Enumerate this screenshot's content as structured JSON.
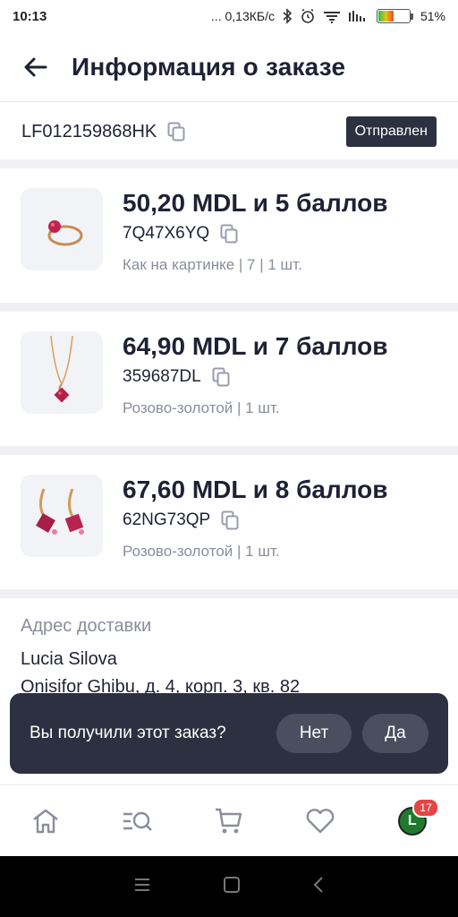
{
  "status_bar": {
    "time": "10:13",
    "net_speed": "... 0,13КБ/с",
    "battery_percent": "51%",
    "battery_level": 0.51
  },
  "header": {
    "title": "Информация о заказе"
  },
  "order": {
    "id": "LF012159868HK",
    "status": "Отправлен"
  },
  "products": [
    {
      "price": "50,20 MDL и 5 баллов",
      "sku": "7Q47X6YQ",
      "variant": "Как на картинке | 7 | 1 шт.",
      "image": "ring-icon"
    },
    {
      "price": "64,90 MDL и 7 баллов",
      "sku": "359687DL",
      "variant": "Розово-золотой | 1 шт.",
      "image": "pendant-icon"
    },
    {
      "price": "67,60 MDL и 8 баллов",
      "sku": "62NG73QP",
      "variant": "Розово-золотой | 1 шт.",
      "image": "earrings-icon"
    }
  ],
  "delivery": {
    "label": "Адрес доставки",
    "name": "Lucia Silova",
    "street": "Onisifor Ghibu, д. 4, корп. 3, кв. 82"
  },
  "toast": {
    "text": "Вы получили этот заказ?",
    "no": "Нет",
    "yes": "Да"
  },
  "bottom_nav": {
    "avatar_letter": "L",
    "notifications": "17"
  },
  "colors": {
    "primary_text": "#1f2235",
    "muted_text": "#8a8d9b",
    "badge_bg": "#2c3040",
    "toast_bg": "#2d3040",
    "avatar_bg": "#1f7a2e",
    "notif_badge": "#e64545"
  }
}
